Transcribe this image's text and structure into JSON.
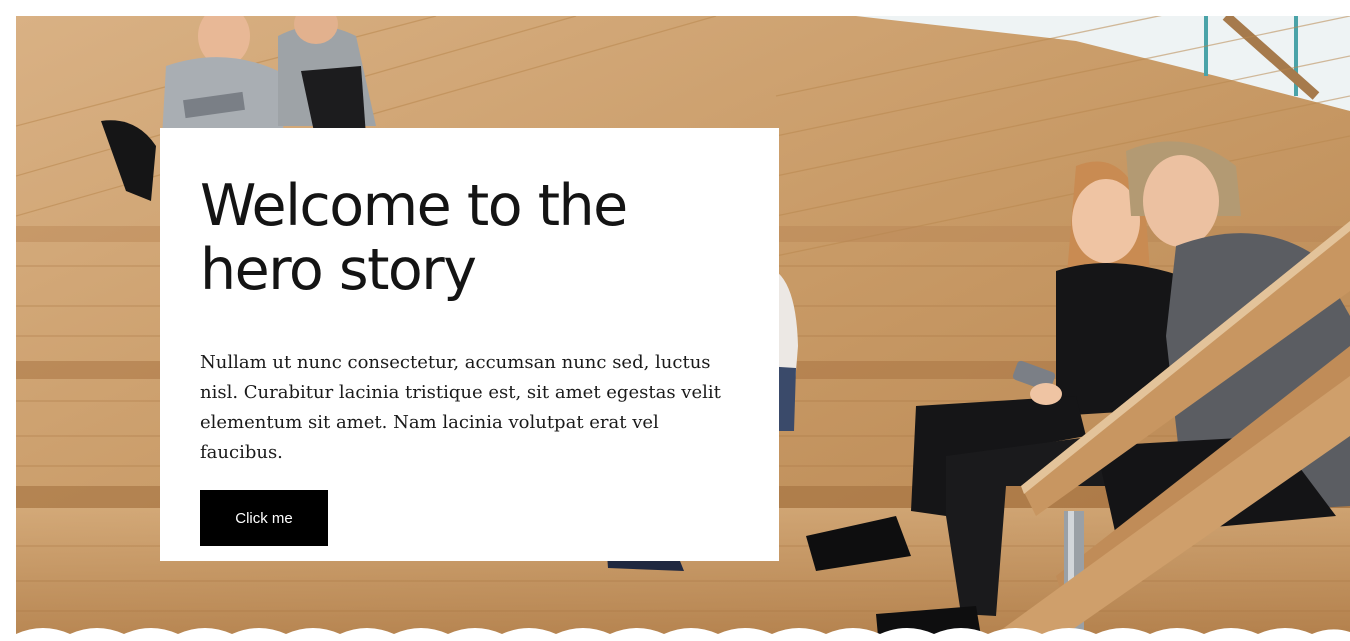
{
  "hero": {
    "title": "Welcome to the hero story",
    "body": "Nullam ut nunc consectetur, accumsan nunc sed, luctus nisl. Curabitur lacinia tristique est, sit amet egestas velit elementum sit amet. Nam lacinia volutpat erat vel faucibus.",
    "cta_label": "Click me"
  },
  "colors": {
    "card_background": "#ffffff",
    "button_background": "#000000",
    "button_text": "#ffffff",
    "wood": "#c99b66"
  }
}
